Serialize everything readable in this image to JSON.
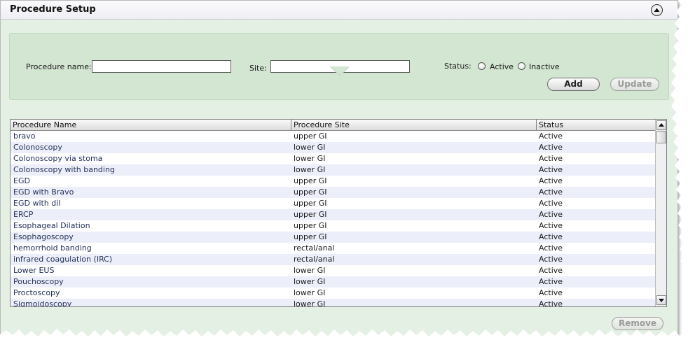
{
  "panel": {
    "title": "Procedure Setup",
    "collapse_icon": "chevron-up-circle-icon"
  },
  "form": {
    "procedure_name_label": "Procedure name:",
    "procedure_name_value": "",
    "site_label": "Site:",
    "site_value": "",
    "status_label": "Status:",
    "status_options": [
      "Active",
      "Inactive"
    ],
    "status_selected": null,
    "add_label": "Add",
    "update_label": "Update"
  },
  "grid": {
    "columns": [
      "Procedure Name",
      "Procedure Site",
      "Status"
    ],
    "rows": [
      [
        "bravo",
        "upper GI",
        "Active"
      ],
      [
        "Colonoscopy",
        "lower GI",
        "Active"
      ],
      [
        "Colonoscopy via stoma",
        "lower GI",
        "Active"
      ],
      [
        "Colonoscopy with banding",
        "lower GI",
        "Active"
      ],
      [
        "EGD",
        "upper GI",
        "Active"
      ],
      [
        "EGD with Bravo",
        "upper GI",
        "Active"
      ],
      [
        "EGD with dil",
        "upper GI",
        "Active"
      ],
      [
        "ERCP",
        "upper GI",
        "Active"
      ],
      [
        "Esophageal Dilation",
        "upper GI",
        "Active"
      ],
      [
        "Esophagoscopy",
        "upper GI",
        "Active"
      ],
      [
        "hemorrhoid banding",
        "rectal/anal",
        "Active"
      ],
      [
        "infrared coagulation (IRC)",
        "rectal/anal",
        "Active"
      ],
      [
        "Lower EUS",
        "lower GI",
        "Active"
      ],
      [
        "Pouchoscopy",
        "lower GI",
        "Active"
      ],
      [
        "Proctoscopy",
        "lower GI",
        "Active"
      ],
      [
        "Sigmoidoscopy",
        "lower GI",
        "Active"
      ]
    ]
  },
  "footer": {
    "remove_label": "Remove"
  }
}
